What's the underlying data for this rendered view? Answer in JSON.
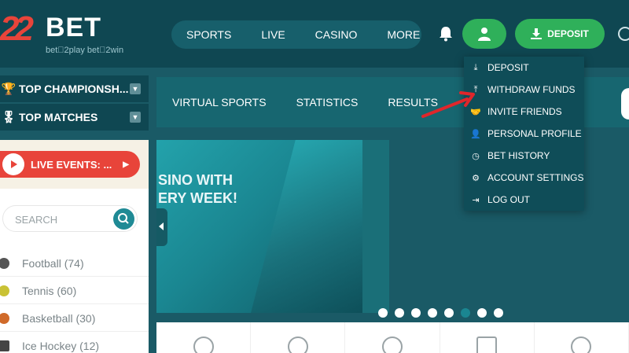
{
  "brand": {
    "logo_digits": "22",
    "logo_word": "BET",
    "tagline": "bet⃝2play  bet⃝2win",
    "accent": "#2fb05a",
    "primary_dark": "#0f4752",
    "live_color": "#e8443a"
  },
  "header": {
    "nav": [
      "SPORTS",
      "LIVE",
      "CASINO",
      "MORE"
    ],
    "deposit_label": "DEPOSIT"
  },
  "sidebar": {
    "top_championships": "TOP CHAMPIONSH...",
    "top_matches": "TOP MATCHES",
    "live_events": "LIVE EVENTS: ...",
    "search_placeholder": "SEARCH",
    "sports": [
      {
        "name": "Football",
        "count": "(74)",
        "color": "#555555"
      },
      {
        "name": "Tennis",
        "count": "(60)",
        "color": "#c9c235"
      },
      {
        "name": "Basketball",
        "count": "(30)",
        "color": "#d06a2a"
      },
      {
        "name": "Ice Hockey",
        "count": "(12)",
        "color": "#444444"
      }
    ]
  },
  "subnav": [
    "VIRTUAL SPORTS",
    "STATISTICS",
    "RESULTS"
  ],
  "banner": {
    "line1": "SINO WITH",
    "line2": "ERY WEEK!",
    "dots_total": 8,
    "active_dot": 6
  },
  "account_menu": {
    "items": [
      {
        "label": "DEPOSIT",
        "icon": "download-icon"
      },
      {
        "label": "WITHDRAW FUNDS",
        "icon": "upload-icon"
      },
      {
        "label": "INVITE FRIENDS",
        "icon": "handshake-icon"
      },
      {
        "label": "PERSONAL PROFILE",
        "icon": "user-plus-icon"
      },
      {
        "label": "BET HISTORY",
        "icon": "clock-icon"
      },
      {
        "label": "ACCOUNT SETTINGS",
        "icon": "cogs-icon"
      },
      {
        "label": "LOG OUT",
        "icon": "logout-icon"
      }
    ]
  }
}
